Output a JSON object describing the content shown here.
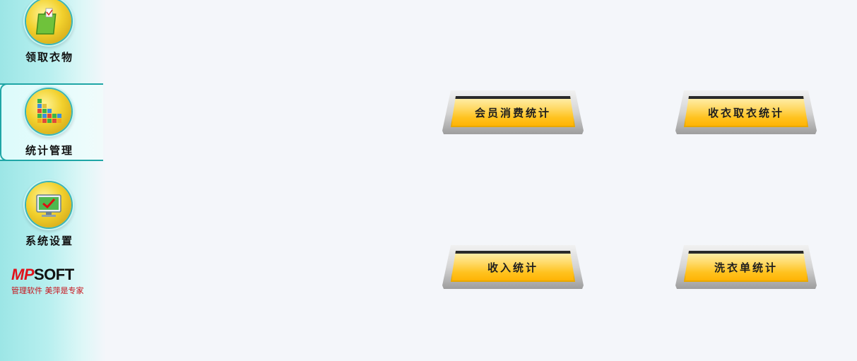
{
  "sidebar": {
    "items": [
      {
        "label": "领取衣物",
        "icon": "shopping-bag-icon"
      },
      {
        "label": "统计管理",
        "icon": "bar-chart-icon",
        "active": true
      },
      {
        "label": "系统设置",
        "icon": "monitor-check-icon"
      }
    ]
  },
  "brand": {
    "logo_mp": "MP",
    "logo_soft": "SOFT",
    "tagline": "管理软件  美萍是专家",
    "accent": "#e0121b"
  },
  "main": {
    "buttons": [
      {
        "label": "会员消费统计"
      },
      {
        "label": "收衣取衣统计"
      },
      {
        "label": "收入统计"
      },
      {
        "label": "洗衣单统计"
      }
    ]
  },
  "colors": {
    "sidebar_teal": "#9ce6e6",
    "active_border": "#1fa6a6",
    "button_gold": "#ffc21e",
    "background": "#f4f6fa"
  }
}
